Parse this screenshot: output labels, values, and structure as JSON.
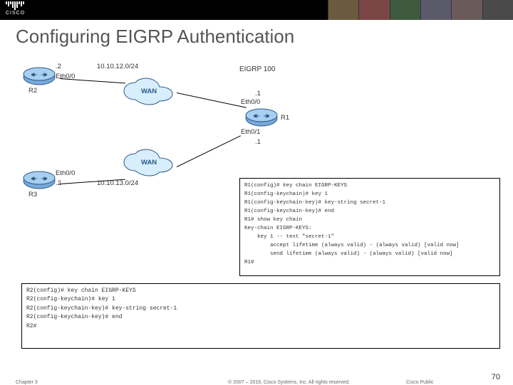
{
  "header": {
    "brand": "CISCO"
  },
  "title": "Configuring EIGRP Authentication",
  "diagram": {
    "eigrp_label": "EIGRP 100",
    "routers": {
      "r1": {
        "name": "R1",
        "int_top": "Eth0/0",
        "addr_top": ".1",
        "int_bottom": "Eth0/1",
        "addr_bottom": ".1"
      },
      "r2": {
        "name": "R2",
        "int": "Eth0/0",
        "addr": ".2",
        "subnet": "10.10.12.0/24"
      },
      "r3": {
        "name": "R3",
        "int": "Eth0/0",
        "addr": ".2",
        "subnet": "10.10.13.0/24"
      }
    },
    "wan_label": "WAN"
  },
  "code_r1": {
    "l1": "R1(config)# key chain EIGRP-KEYS",
    "l2": "R1(config-keychain)# key 1",
    "l3": "R1(config-keychain-key)# key-string secret-1",
    "l4": "R1(config-keychain-key)# end",
    "l5": "R1# show key chain",
    "l6": "Key-chain EIGRP-KEYS:",
    "l7": "    key 1 -- text \"secret-1\"",
    "l8": "        accept lifetime (always valid) - (always valid) [valid now]",
    "l9": "        send lifetime (always valid) - (always valid) [valid now]",
    "l10": "R1#"
  },
  "code_r2": {
    "l1": "R2(config)# key chain EIGRP-KEYS",
    "l2": "R2(config-keychain)# key 1",
    "l3": "R2(config-keychain-key)# key-string secret-1",
    "l4": "R2(config-keychain-key)# end",
    "l5": "R2#"
  },
  "footer": {
    "chapter": "Chapter 3",
    "copyright": "© 2007 – 2016, Cisco Systems, Inc. All rights reserved.",
    "label": "Cisco Public",
    "page": "70"
  }
}
